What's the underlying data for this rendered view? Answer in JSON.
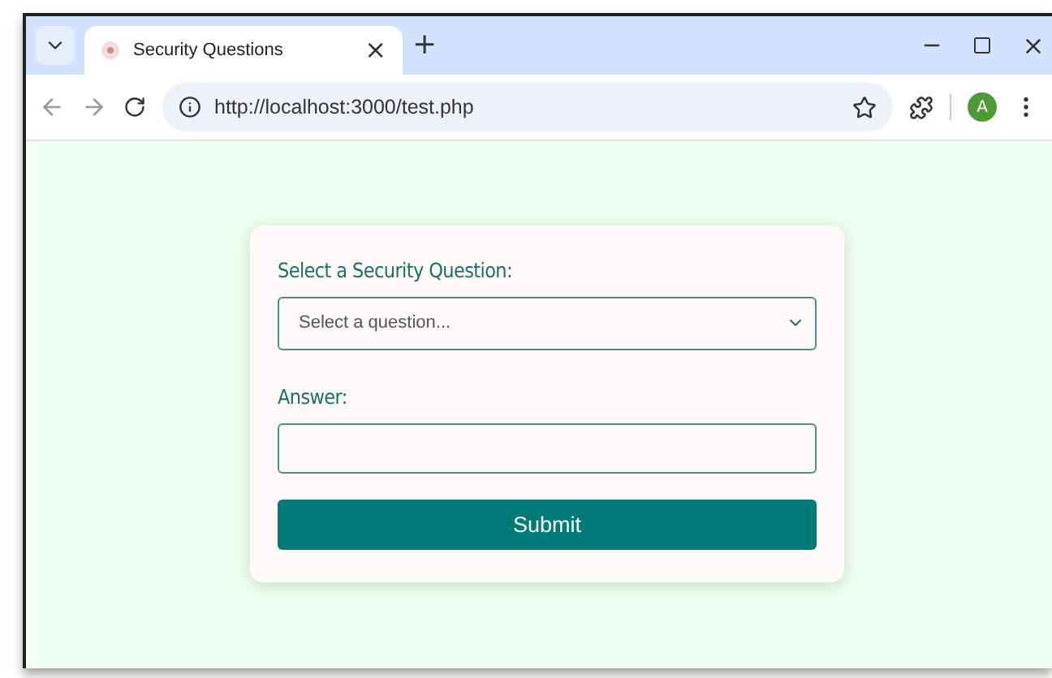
{
  "browser": {
    "tab": {
      "title": "Security Questions",
      "close": "×"
    },
    "new_tab": "+",
    "address": "http://localhost:3000/test.php",
    "profile_initial": "A"
  },
  "form": {
    "question_label": "Select a Security Question:",
    "question_select": {
      "placeholder": "Select a question..."
    },
    "answer_label": "Answer:",
    "submit": "Submit"
  }
}
